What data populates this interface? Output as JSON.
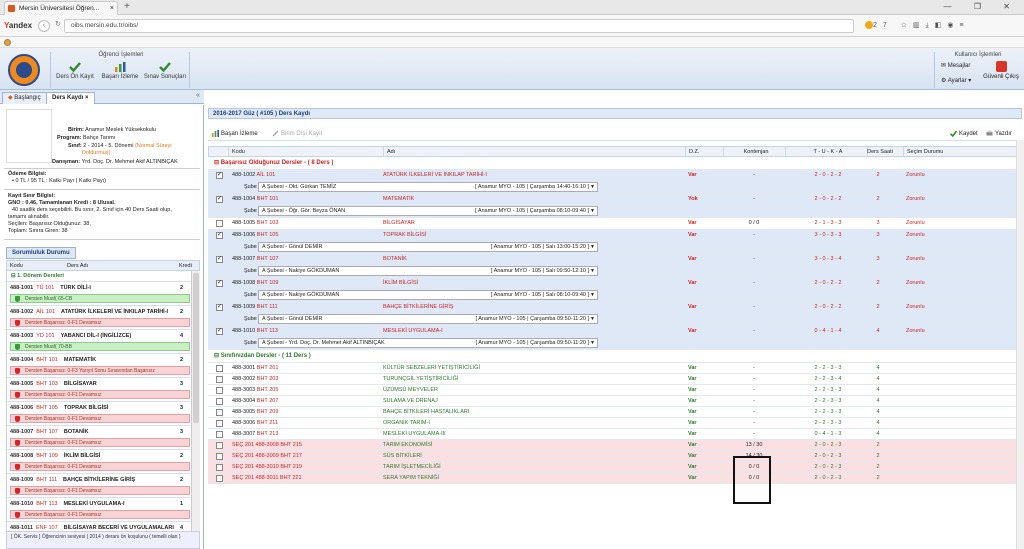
{
  "browser": {
    "tab_title": "Mersin Üniversitesi Öğren...",
    "tab_close": "×",
    "new_tab": "+",
    "window_controls": "— ❐ ✕",
    "brand_y": "Y",
    "brand_rest": "andex",
    "url": "oibs.mersin.edu.tr/oibs/",
    "badge_count": "27"
  },
  "header": {
    "ops_title": "Öğrenci İşlemleri",
    "ops": [
      {
        "label": "Ders Ön Kayıt",
        "icon": "check-icon",
        "color": "#2e8b2e"
      },
      {
        "label": "Başarı İzleme",
        "icon": "bar-chart-icon",
        "color": "#e08a1c"
      },
      {
        "label": "Sınav Sonuçları",
        "icon": "check-icon",
        "color": "#2e8b2e"
      }
    ],
    "user_title": "Kullanıcı İşlemleri",
    "mesajlar": "Mesajlar",
    "ayarlar": "Ayarlar ▾",
    "logout": "Güvenli Çıkış"
  },
  "app_tabs": {
    "home": "Başlangıç",
    "current": "Ders Kaydı ×",
    "collapse": "«"
  },
  "student": {
    "birim_label": "Birim:",
    "birim": "Anamur Meslek Yüksekokulu",
    "program_label": "Program:",
    "program": "Bahçe Tarımı",
    "sinif_label": "Sınıf:",
    "sinif": "2 - 2014 - 5. Dönemi ",
    "sinif_status": "(Normal Süreyi",
    "sinif_status2": "Doldurmuş)",
    "danisman_label": "Danışman:",
    "danisman": "Yrd. Doç. Dr. Mehmet Akif ALTINBIÇAK",
    "odeme_title": "Ödeme Bilgisi:",
    "odeme": "• 0 TL / 95 TL : Katkı Payı ( Katkı Payı)",
    "kayit_title": "Kayıt Sınır Bilgisi:",
    "gno": "GNO : 0.46, Tamamlanan Kredi : 8 Ulusal.",
    "limit1": "40 saatlik ders seçebilirli. Bu sınır, 2. Sınıf için 40 Ders Saati olup,",
    "limit2": "tamamı alınabilir.",
    "secilen": "Seçilen: Başarısız Olduğunuz: 38,",
    "toplam": "Toplam: Sınıra Giren: 38"
  },
  "sorumluluk": {
    "tab": "Sorumluluk Durumu",
    "col_kod": "Kodu",
    "col_ad": "Ders Adı",
    "col_kr": "Kredi",
    "donem_title": "⊟ 1. Dönem Dersleri",
    "courses": [
      {
        "code": "488-1001",
        "code2": "TÜ 101",
        "name": "TÜRK DİLİ-I",
        "kr": "2",
        "status": "Dersten Muaf( 65-CB",
        "ok": true
      },
      {
        "code": "488-1002",
        "code2": "AİL 101",
        "name": "ATATÜRK İLKELERİ VE İNKILAP TARİHİ-I",
        "kr": "2",
        "status": "Dersten Başarısız: 0-F1 Devamsız",
        "ok": false
      },
      {
        "code": "488-1003",
        "code2": "YD 101",
        "name": "YABANCI DİL-I (İNGİLİZCE)",
        "kr": "4",
        "status": "Dersten Muaf( 70-BB",
        "ok": true
      },
      {
        "code": "488-1004",
        "code2": "BHT 101",
        "name": "MATEMATİK",
        "kr": "2",
        "status": "Dersten Başarısız: 0-F3 Yarıyıl Sonu Sınavından Başarısız",
        "ok": false
      },
      {
        "code": "488-1005",
        "code2": "BHT 103",
        "name": "BİLGİSAYAR",
        "kr": "3",
        "status": "Dersten Başarısız: 0-F1 Devamsız",
        "ok": false
      },
      {
        "code": "488-1006",
        "code2": "BHT 105",
        "name": "TOPRAK BİLGİSİ",
        "kr": "3",
        "status": "Dersten Başarısız: 0-F1 Devamsız",
        "ok": false
      },
      {
        "code": "488-1007",
        "code2": "BHT 107",
        "name": "BOTANİK",
        "kr": "3",
        "status": "Dersten Başarısız: 0-F1 Devamsız",
        "ok": false
      },
      {
        "code": "488-1008",
        "code2": "BHT 109",
        "name": "İKLİM BİLGİSİ",
        "kr": "2",
        "status": "Dersten Başarısız: 0-F1 Devamsız",
        "ok": false
      },
      {
        "code": "488-1009",
        "code2": "BHT 111",
        "name": "BAHÇE BİTKİLERİNE GİRİŞ",
        "kr": "2",
        "status": "Dersten Başarısız: 0-F1 Devamsız",
        "ok": false
      },
      {
        "code": "488-1010",
        "code2": "BHT 113",
        "name": "MESLEKİ UYGULAMA-I",
        "kr": "1",
        "status": "Dersten Başarısız: 0-F1 Devamsız",
        "ok": false
      },
      {
        "code": "488-1011",
        "code2": "ENF 107",
        "name": "BİLGİSAYAR BECERİ VE UYGULAMALARI",
        "kr": "4",
        "status": "",
        "ok": false
      }
    ],
    "note": "[ ÖK. Servis ] Öğrencinin seviyesi ( 2014 ) deranı ön koşulunu ( temelli olan )"
  },
  "main": {
    "title": "2016-2017 Güz ( #105 ) Ders Kaydı",
    "btn_basari": "Başarı İzleme",
    "btn_dis": "Birim Dışı Kayıt",
    "btn_kaydet": "Kaydet",
    "btn_yazdir": "Yazdır",
    "cols": {
      "kodu": "Kodu",
      "adi": "Adı",
      "dz": "D.Z.",
      "kontenjan": "Kontenjan",
      "tuka": "T - U - K - A",
      "ders_saati": "Ders Saati",
      "secim": "Seçim Durumu"
    },
    "sube_label": "Şube",
    "section_failed": "⊟ Başarısız Olduğunuz Dersler - ( 8 Ders )",
    "failed": [
      {
        "checked": true,
        "code": "488-1002",
        "code2": "AİL 101",
        "name": "ATATÜRK İLKELERİ VE İNKILAP TARİHİ-I",
        "dz": "Var",
        "kon": "-",
        "tuka": "2 - 0 - 2 - 2",
        "ds": "2",
        "sec": "Zorunlu",
        "sube": "A Şubesi - Okt. Gürkan TEMİZ",
        "sube_rt": "[ Anamur MYO - 105 | Çarşamba 14:40-16:10 ]"
      },
      {
        "checked": true,
        "code": "488-1004",
        "code2": "BHT 101",
        "name": "MATEMATİK",
        "dz": "Yok",
        "kon": "-",
        "tuka": "2 - 0 - 2 - 2",
        "ds": "2",
        "sec": "Zorunlu",
        "sube": "A Şubesi - Öğr. Gör. Beyza ÖNAN",
        "sube_rt": "[ Anamur MYO - 105 | Çarşamba 08:10-09:40 ]"
      },
      {
        "checked": false,
        "code": "488-1005",
        "code2": "BHT 103",
        "name": "BİLGİSAYAR",
        "dz": "Var",
        "kon": "0 / 0",
        "tuka": "2 - 1 - 3 - 3",
        "ds": "3",
        "sec": "Zorunlu",
        "sube": "",
        "sube_rt": ""
      },
      {
        "checked": true,
        "code": "488-1006",
        "code2": "BHT 105",
        "name": "TOPRAK BİLGİSİ",
        "dz": "Var",
        "kon": "-",
        "tuka": "3 - 0 - 3 - 3",
        "ds": "3",
        "sec": "Zorunlu",
        "sube": "A Şubesi - Gönül DEMİR",
        "sube_rt": "[ Anamur MYO - 105 | Salı 13:00-15:20 ]"
      },
      {
        "checked": true,
        "code": "488-1007",
        "code2": "BHT 107",
        "name": "BOTANİK",
        "dz": "Var",
        "kon": "-",
        "tuka": "3 - 0 - 3 - 4",
        "ds": "3",
        "sec": "Zorunlu",
        "sube": "A Şubesi - Nakiye GÖKDUMAN",
        "sube_rt": "[ Anamur MYO - 105 | Salı 09:50-12:10 ]"
      },
      {
        "checked": true,
        "code": "488-1008",
        "code2": "BHT 109",
        "name": "İKLİM BİLGİSİ",
        "dz": "Var",
        "kon": "-",
        "tuka": "2 - 0 - 2 - 2",
        "ds": "2",
        "sec": "Zorunlu",
        "sube": "A Şubesi - Nakiye GÖKDUMAN",
        "sube_rt": "[ Anamur MYO - 105 | Salı 08:10-09:40 ]"
      },
      {
        "checked": true,
        "code": "488-1009",
        "code2": "BHT 111",
        "name": "BAHÇE BİTKİLERİNE GİRİŞ",
        "dz": "Var",
        "kon": "-",
        "tuka": "2 - 0 - 2 - 2",
        "ds": "2",
        "sec": "Zorunlu",
        "sube": "A Şubesi - Gönül DEMİR",
        "sube_rt": "[ Anamur MYO - 105 | Çarşamba 09:50-11:20 ]"
      },
      {
        "checked": true,
        "code": "488-1010",
        "code2": "BHT 113",
        "name": "MESLEKİ UYGULAMA-I",
        "dz": "Var",
        "kon": "-",
        "tuka": "0 - 4 - 1 - 4",
        "ds": "4",
        "sec": "Zorunlu",
        "sube": "A Şubesi - Yrd. Doç. Dr. Mehmet Akif ALTINBIÇAK",
        "sube_rt": "[ Anamur MYO - 105 | Çarşamba 09:50-11:20 ]"
      }
    ],
    "section_class": "⊟ Sınıfınızdan Dersler - ( 11 Ders )",
    "class_courses": [
      {
        "pre": "",
        "code": "488-3001",
        "code2": "BHT 201",
        "name": "KÜLTÜR SEBZELERİ YETİŞTİRİCİLİĞİ",
        "kon": "-",
        "tuka": "2 - 2 - 3 - 3",
        "ds": "4",
        "pink": false
      },
      {
        "pre": "",
        "code": "488-3002",
        "code2": "BHT 203",
        "name": "TURUNÇGİL YETİŞTİRİCİLİĞİ",
        "kon": "-",
        "tuka": "2 - 2 - 3 - 4",
        "ds": "4",
        "pink": false
      },
      {
        "pre": "",
        "code": "488-3003",
        "code2": "BHT 205",
        "name": "ÜZÜMSÜ MEYVELER",
        "kon": "-",
        "tuka": "2 - 2 - 3 - 3",
        "ds": "4",
        "pink": false
      },
      {
        "pre": "",
        "code": "488-3004",
        "code2": "BHT 207",
        "name": "SULAMA VE DRENAJ",
        "kon": "-",
        "tuka": "2 - 2 - 3 - 3",
        "ds": "4",
        "pink": false
      },
      {
        "pre": "",
        "code": "488-3005",
        "code2": "BHT 209",
        "name": "BAHÇE BİTKİLERİ HASTALIKLARI",
        "kon": "-",
        "tuka": "2 - 2 - 3 - 3",
        "ds": "4",
        "pink": false
      },
      {
        "pre": "",
        "code": "488-3006",
        "code2": "BHT 211",
        "name": "ORGANİK TARIM-I",
        "kon": "-",
        "tuka": "2 - 2 - 3 - 3",
        "ds": "4",
        "pink": false
      },
      {
        "pre": "",
        "code": "488-3007",
        "code2": "BHT 213",
        "name": "MESLEKİ UYGULAMA-III",
        "kon": "-",
        "tuka": "0 - 4 - 1 - 3",
        "ds": "4",
        "pink": false
      },
      {
        "pre": "SEÇ 201",
        "code": "488-3008",
        "code2": "BHT 215",
        "name": "TARIM EKONOMİSİ",
        "kon": "13 / 30",
        "tuka": "2 - 0 - 2 - 3",
        "ds": "2",
        "pink": true
      },
      {
        "pre": "SEÇ 201",
        "code": "488-3009",
        "code2": "BHT 217",
        "name": "SÜS BİTKİLERİ",
        "kon": "14 / 30",
        "tuka": "2 - 0 - 2 - 3",
        "ds": "2",
        "pink": true
      },
      {
        "pre": "SEÇ 201",
        "code": "488-3010",
        "code2": "BHT 219",
        "name": "TARIM İŞLETMECİLİĞİ",
        "kon": "0 / 0",
        "tuka": "2 - 0 - 2 - 3",
        "ds": "2",
        "pink": true
      },
      {
        "pre": "SEÇ 201",
        "code": "488-3011",
        "code2": "BHT 221",
        "name": "SERA YAPIM TEKNİĞİ",
        "kon": "0 / 0",
        "tuka": "2 - 0 - 2 - 3",
        "ds": "2",
        "pink": true
      }
    ],
    "class_dz": "Var"
  },
  "colors": {
    "accent": "#1c3f7a",
    "fail": "#cc2222",
    "ok": "#2a7a2a"
  }
}
